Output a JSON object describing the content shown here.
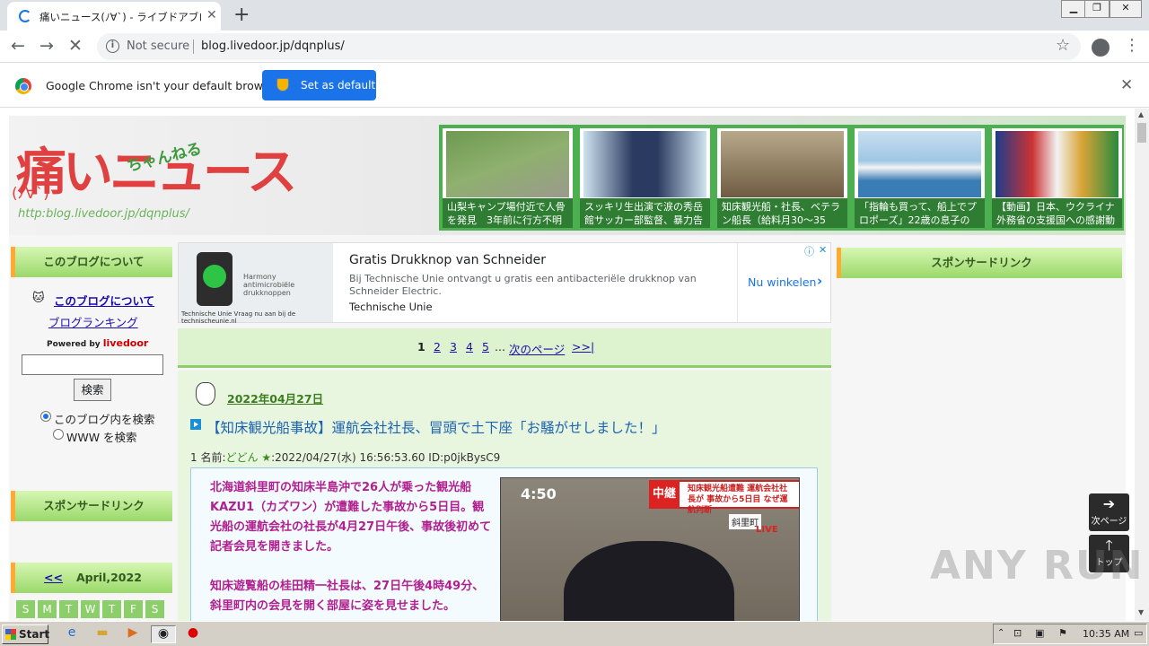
{
  "browser": {
    "tab_title": "痛いニュース(ﾉ∀`) - ライブドアブログ",
    "url_security": "Not secure",
    "url": "blog.livedoor.jp/dqnplus/",
    "infobar_text": "Google Chrome isn't your default browser",
    "set_default_label": "Set as default"
  },
  "header": {
    "logo_text": "痛いニュース",
    "logo_chan": "ちゃんねる",
    "logo_face": "(ﾉ∀`)",
    "logo_url": "http:blog.livedoor.jp/dqnplus/",
    "thumbnails": [
      {
        "caption": "山梨キャンプ場付近で人骨を発見　3年前に行方不明"
      },
      {
        "caption": "スッキリ生出演で涙の秀岳館サッカー部監督、暴力告"
      },
      {
        "caption": "知床観光船・社長、ベテラン船長（給料月30～35"
      },
      {
        "caption": "「指輪も買って、船上でプロポーズ」22歳の息子の"
      },
      {
        "caption": "【動画】日本、ウクライナ外務省の支援国への感謝動"
      }
    ]
  },
  "left_sidebar": {
    "about_heading": "このブログについて",
    "about_link": "このブログについて",
    "ranking_link": "ブログランキング",
    "powered_by": "Powered by",
    "livedoor": "livedoor",
    "search_button": "検索",
    "radio_blog": "このブログ内を検索",
    "radio_www": "WWW を検索",
    "sponsor_heading": "スポンサードリンク",
    "calendar_prev": "<<",
    "calendar_month": "April,2022",
    "calendar_days": [
      "S",
      "M",
      "T",
      "W",
      "T",
      "F",
      "S"
    ]
  },
  "ad": {
    "title": "Gratis Drukknop van Schneider",
    "desc": "Bij Technische Unie ontvangt u gratis een antibacteriële drukknop van Schneider Electric.",
    "brand": "Technische Unie",
    "cta": "Nu winkelen",
    "img_text": "Harmony antimicrobiële drukknoppen",
    "img_footer": "Technische Unie   Vraag nu aan bij de technischeunie.nl"
  },
  "pager": {
    "pages": [
      "1",
      "2",
      "3",
      "4",
      "5"
    ],
    "ellipsis": "...",
    "next": "次のページ",
    "last": ">>|"
  },
  "post": {
    "date": "2022年04月27日",
    "title": "【知床観光船事故】運航会社社長、冒頭で土下座「お騒がせしました！」",
    "meta_num": "1 名前:",
    "meta_name": "どどん",
    "meta_star": "★",
    "meta_rest": ":2022/04/27(水) 16:56:53.60 ID:p0jkBysC9",
    "para1": "北海道斜里町の知床半島沖で26人が乗った観光船KAZU1（カズワン）が遭難した事故から5日目。観光船の運航会社の社長が4月27日午後、事故後初めて記者会見を開きました。",
    "para2": "知床遊覧船の桂田精一社長は、27日午後4時49分、斜里町内の会見を開く部屋に姿を見せました。",
    "tv_time": "4:50",
    "tv_tag": "中継",
    "tv_banner": "知床観光船遭難 運航会社社長が 事故から5日目 なぜ運航判断",
    "tv_location": "斜里町",
    "tv_live": "LIVE"
  },
  "right_sidebar": {
    "sponsor_heading": "スポンサードリンク"
  },
  "float_nav": {
    "next_label": "次ページ",
    "top_label": "トップ"
  },
  "watermark": "ANY RUN",
  "taskbar": {
    "start_label": "Start",
    "clock": "10:35 AM"
  }
}
